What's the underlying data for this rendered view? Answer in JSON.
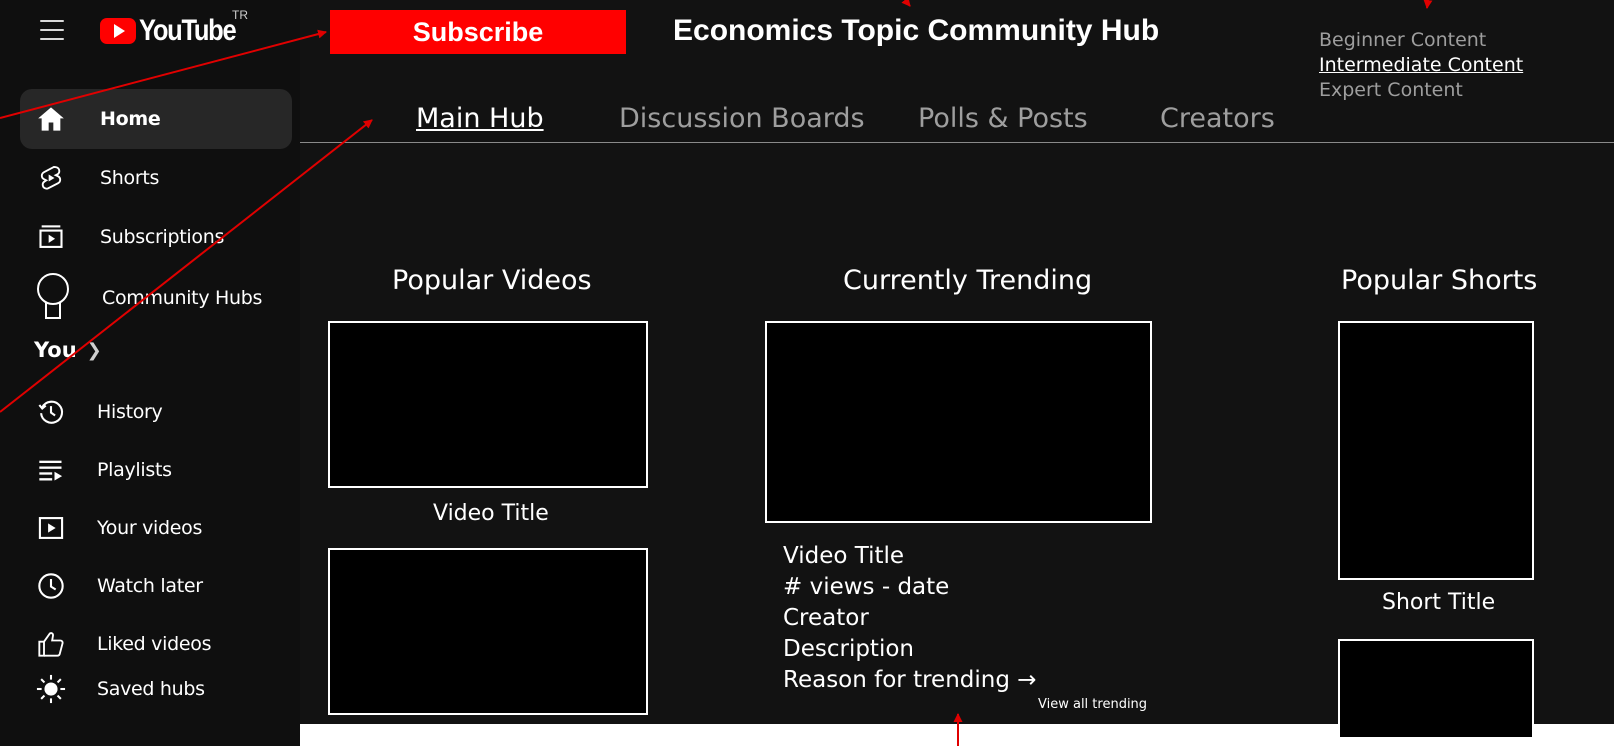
{
  "brand": {
    "name": "YouTube",
    "country": "TR"
  },
  "sidebar": {
    "items": [
      {
        "label": "Home",
        "icon": "home-icon"
      },
      {
        "label": "Shorts",
        "icon": "shorts-icon"
      },
      {
        "label": "Subscriptions",
        "icon": "subscriptions-icon"
      },
      {
        "label": "Community Hubs",
        "icon": "lightbulb-icon"
      }
    ],
    "you_label": "You",
    "you_items": [
      {
        "label": "History",
        "icon": "history-icon"
      },
      {
        "label": "Playlists",
        "icon": "playlists-icon"
      },
      {
        "label": "Your videos",
        "icon": "your-videos-icon"
      },
      {
        "label": "Watch later",
        "icon": "clock-icon"
      },
      {
        "label": "Liked videos",
        "icon": "thumbs-up-icon"
      },
      {
        "label": "Saved hubs",
        "icon": "sun-icon"
      }
    ]
  },
  "header": {
    "subscribe_label": "Subscribe",
    "title": "Economics Topic Community Hub",
    "levels": [
      "Beginner Content",
      "Intermediate Content",
      "Expert Content"
    ],
    "selected_level": "Intermediate Content"
  },
  "tabs": [
    "Main Hub",
    "Discussion Boards",
    "Polls & Posts",
    "Creators"
  ],
  "active_tab": "Main Hub",
  "sections": {
    "popular_videos": {
      "heading": "Popular Videos",
      "caption": "Video Title"
    },
    "trending": {
      "heading": "Currently Trending",
      "lines": [
        "Video Title",
        "# views - date",
        "Creator",
        "Description",
        "Reason for trending →"
      ],
      "view_all": "View all trending"
    },
    "popular_shorts": {
      "heading": "Popular Shorts",
      "caption": "Short Title"
    }
  },
  "colors": {
    "accent": "#ff0000",
    "background": "#121212",
    "sidebar": "#0f0f0f",
    "annotation": "#e00000"
  }
}
